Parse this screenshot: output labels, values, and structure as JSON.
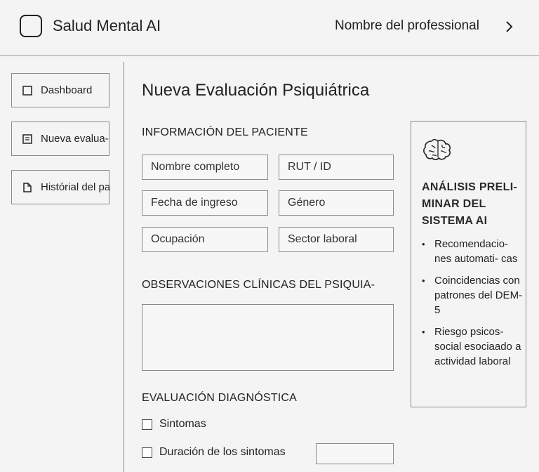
{
  "header": {
    "app_title": "Salud Mental AI",
    "professional_link": "Nombre del professional"
  },
  "sidebar": {
    "items": [
      {
        "label": "Dashboard",
        "icon": "square-icon"
      },
      {
        "label": "Nueva evalua-",
        "icon": "form-icon"
      },
      {
        "label": "Histórial del pa",
        "icon": "document-icon"
      }
    ]
  },
  "main": {
    "title": "Nueva Evaluación Psiquiátrica",
    "patient_section": {
      "heading": "INFORMACIÓN DEL PACIENTE",
      "fields": {
        "nombre": "Nombre completo",
        "rut": "RUT / ID",
        "fecha": "Fecha de ingreso",
        "genero": "Género",
        "ocupacion": "Ocupación",
        "sector": "Sector laboral"
      }
    },
    "observations_section": {
      "heading": "OBSERVACIONES CLÍNICAS DEL PSIQUIA-"
    },
    "diagnostic_section": {
      "heading": "EVALUACIÓN DIAGNÓSTICA",
      "sintomas_label": "Sintomas",
      "duracion_label": "Duración de los sintomas"
    }
  },
  "ai_panel": {
    "icon": "brain-icon",
    "title": "ANÁLISIS PRELI- MINAR DEL SISTEMA AI",
    "items": [
      "Recomendacio- nes automati- cas",
      "Coincidencias con patrones del DEM-5",
      "Riesgo psicos- social esociaado a actividad laboral"
    ]
  }
}
